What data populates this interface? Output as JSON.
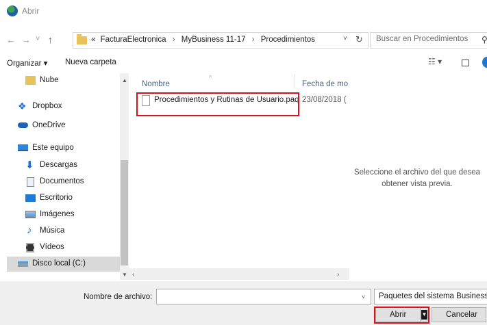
{
  "window": {
    "title": "Abrir"
  },
  "address": {
    "back": "←",
    "forward": "→",
    "recent": "˅",
    "up": "↑",
    "overflow": "«",
    "crumbs": [
      "FacturaElectronica",
      "MyBusiness 11-17",
      "Procedimientos"
    ],
    "separator": "›",
    "dropdown": "˅",
    "refresh": "↻"
  },
  "search": {
    "placeholder": "Buscar en Procedimientos",
    "icon": "search-icon"
  },
  "toolbar": {
    "organize_label": "Organizar ▾",
    "new_folder_label": "Nueva carpeta",
    "view_label": "☷ ▾"
  },
  "sidebar": {
    "items": [
      {
        "label": "Nube",
        "icon": "folder-icon"
      },
      {
        "label": "Dropbox",
        "icon": "dropbox-icon"
      },
      {
        "label": "OneDrive",
        "icon": "onedrive-icon"
      },
      {
        "label": "Este equipo",
        "icon": "computer-icon"
      },
      {
        "label": "Descargas",
        "icon": "download-icon"
      },
      {
        "label": "Documentos",
        "icon": "documents-icon"
      },
      {
        "label": "Escritorio",
        "icon": "desktop-icon"
      },
      {
        "label": "Imágenes",
        "icon": "pictures-icon"
      },
      {
        "label": "Música",
        "icon": "music-icon"
      },
      {
        "label": "Vídeos",
        "icon": "videos-icon"
      },
      {
        "label": "Disco local (C:)",
        "icon": "drive-icon",
        "selected": true
      }
    ]
  },
  "file_list": {
    "columns": [
      "Nombre",
      "Fecha de mo"
    ],
    "sort_indicator": "^",
    "files": [
      {
        "name": "Procedimientos y Rutinas de Usuario.paq",
        "date": "23/08/2018 ( "
      }
    ]
  },
  "preview": {
    "message": "Seleccione el archivo del que desea obtener vista previa."
  },
  "footer": {
    "filename_label": "Nombre de archivo:",
    "filename_value": "",
    "filetype_value": "Paquetes del sistema Business",
    "open_label": "Abrir",
    "cancel_label": "Cancelar"
  },
  "colors": {
    "highlight": "#e0101a",
    "selection": "#d9d9d9",
    "folder": "#e8c25a",
    "accent": "#1f77d0"
  }
}
